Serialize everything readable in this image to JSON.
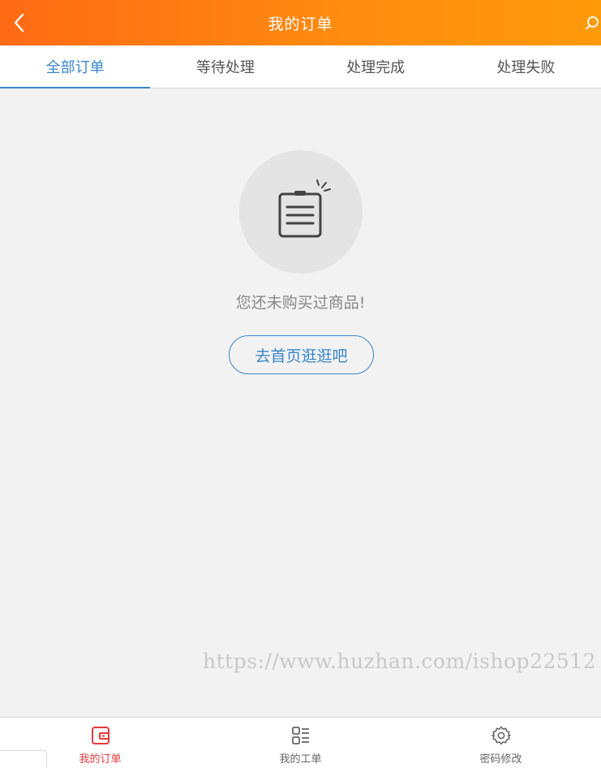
{
  "header": {
    "title": "我的订单",
    "back_icon": "chevron-left-icon",
    "search_icon": "search-icon"
  },
  "tabs": [
    {
      "label": "全部订单",
      "active": true
    },
    {
      "label": "等待处理",
      "active": false
    },
    {
      "label": "处理完成",
      "active": false
    },
    {
      "label": "处理失败",
      "active": false
    }
  ],
  "empty_state": {
    "icon": "notepad-icon",
    "message": "您还未购买过商品!",
    "button_label": "去首页逛逛吧"
  },
  "watermark": "https://www.huzhan.com/ishop22512",
  "bottom_nav": [
    {
      "label": "我的订单",
      "icon": "wallet-icon",
      "active": true
    },
    {
      "label": "我的工单",
      "icon": "list-icon",
      "active": false
    },
    {
      "label": "密码修改",
      "icon": "gear-icon",
      "active": false
    }
  ],
  "colors": {
    "header_start": "#ff6a14",
    "header_end": "#ff9a0a",
    "accent": "#3a86c8",
    "nav_active": "#e4393c"
  }
}
